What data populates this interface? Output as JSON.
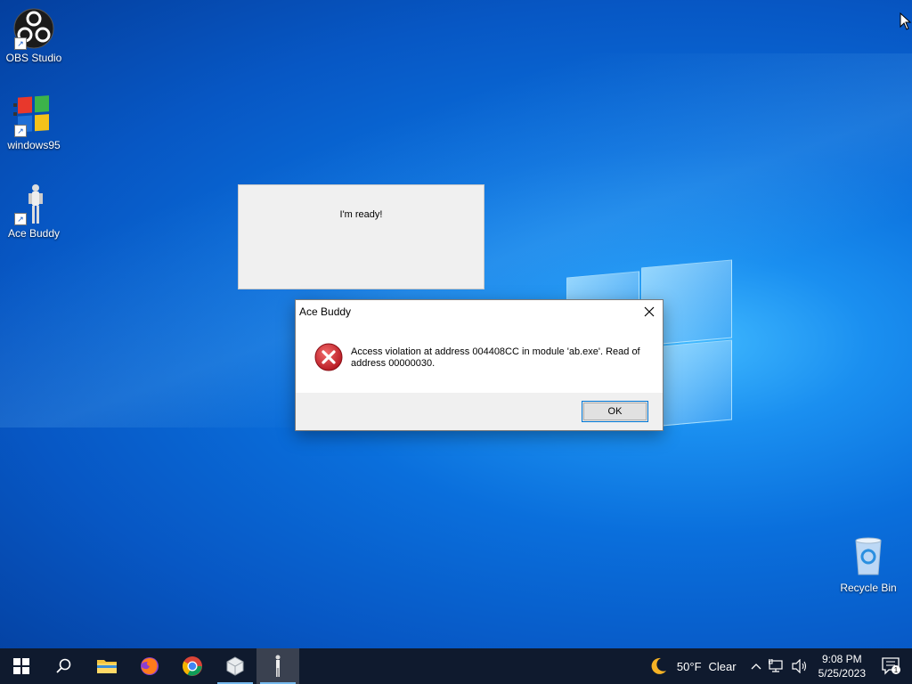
{
  "desktop": {
    "icons": [
      {
        "label": "OBS Studio",
        "icon": "obs-icon"
      },
      {
        "label": "windows95",
        "icon": "windows95-icon"
      },
      {
        "label": "Ace Buddy",
        "icon": "ace-buddy-icon"
      }
    ],
    "recycle_bin": {
      "label": "Recycle Bin",
      "icon": "recycle-bin-icon"
    }
  },
  "ready_window": {
    "text": "I'm ready!"
  },
  "dialog": {
    "title": "Ace Buddy",
    "message": "Access violation at address 004408CC in module 'ab.exe'. Read of address 00000030.",
    "ok_label": "OK",
    "icon": "error-icon"
  },
  "taskbar": {
    "buttons": [
      {
        "name": "start",
        "icon": "windows-start-icon"
      },
      {
        "name": "search",
        "icon": "search-icon"
      },
      {
        "name": "file-explorer",
        "icon": "folder-icon"
      },
      {
        "name": "firefox",
        "icon": "firefox-icon"
      },
      {
        "name": "chrome",
        "icon": "chrome-icon"
      },
      {
        "name": "app",
        "icon": "cube-icon"
      },
      {
        "name": "ace-buddy",
        "icon": "ace-buddy-icon"
      }
    ],
    "weather": {
      "temp": "50°F",
      "condition": "Clear",
      "icon": "moon-icon"
    },
    "clock": {
      "time": "9:08 PM",
      "date": "5/25/2023"
    },
    "notification_count": "1"
  },
  "colors": {
    "taskbar": "#0f1a2e",
    "accent": "#0078d7",
    "error_red": "#d8242f"
  }
}
